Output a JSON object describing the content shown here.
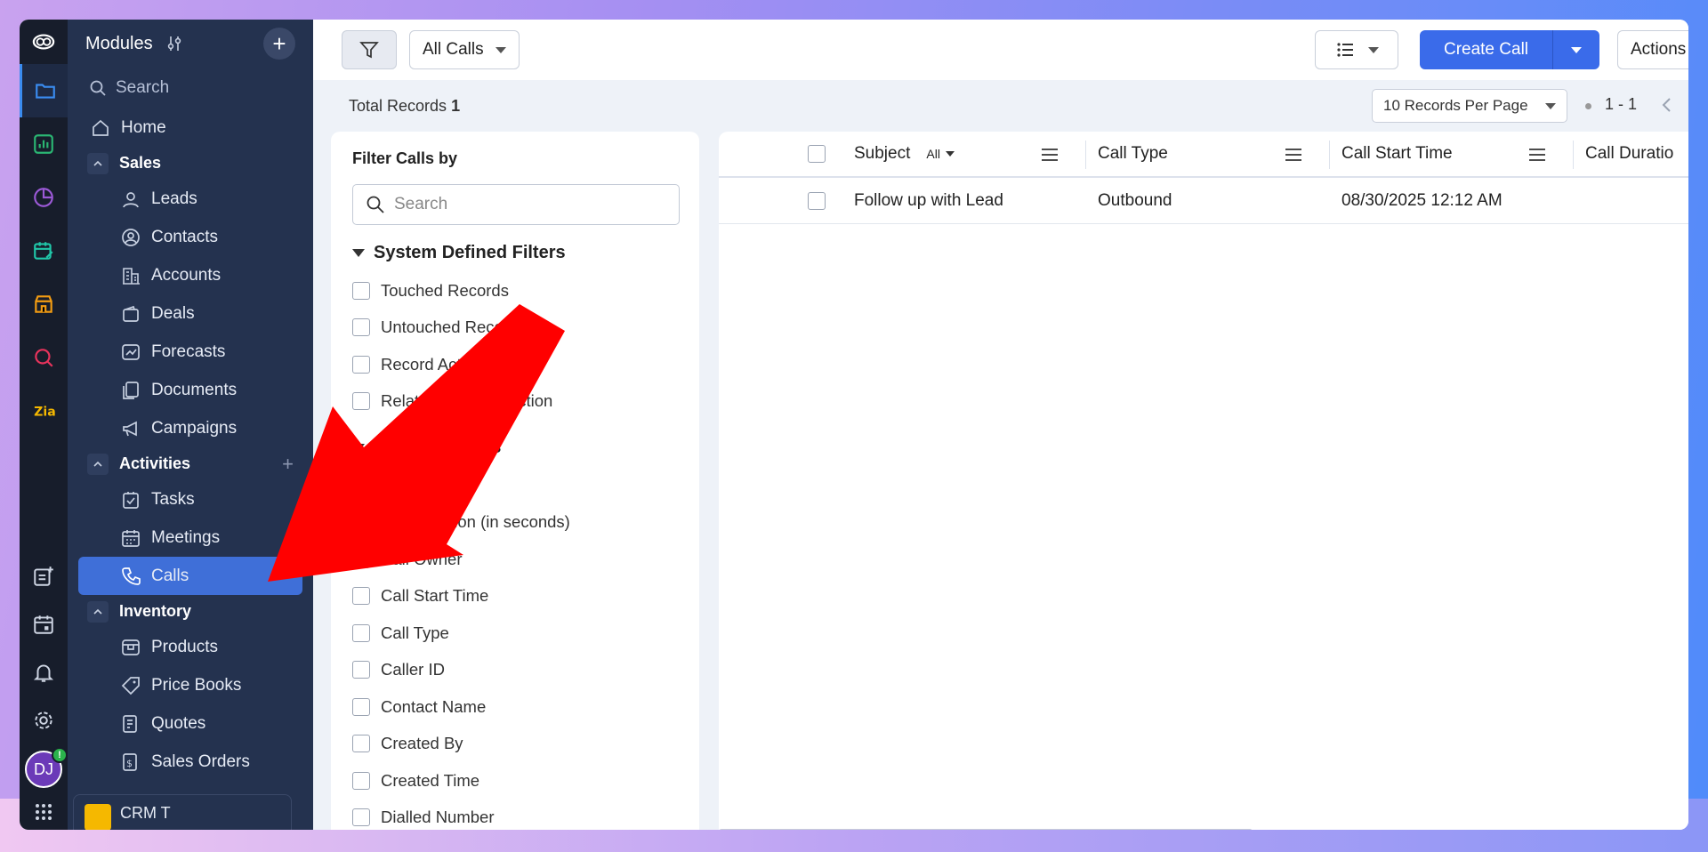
{
  "sidebar": {
    "title": "Modules",
    "search_placeholder": "Search",
    "home": "Home",
    "groups": {
      "sales": "Sales",
      "activities": "Activities",
      "inventory": "Inventory"
    },
    "sales_items": [
      "Leads",
      "Contacts",
      "Accounts",
      "Deals",
      "Forecasts",
      "Documents",
      "Campaigns"
    ],
    "activities_items": [
      "Tasks",
      "Meetings",
      "Calls"
    ],
    "inventory_items": [
      "Products",
      "Price Books",
      "Quotes",
      "Sales Orders"
    ],
    "more": "•••",
    "footer_label": "CRM T",
    "avatar_initials": "DJ",
    "avatar_badge": "!"
  },
  "toolbar": {
    "view_select": "All Calls",
    "create_label": "Create Call",
    "actions_label": "Actions"
  },
  "subbar": {
    "total_label": "Total Records",
    "total_value": "1",
    "per_page": "10 Records Per Page",
    "range": "1 - 1"
  },
  "filter_panel": {
    "title": "Filter Calls by",
    "search_placeholder": "Search",
    "system_title": "System Defined Filters",
    "system_filters": [
      "Touched Records",
      "Untouched Records",
      "Record Action",
      "Related Records Action"
    ],
    "fields_title": "Filter By Fields",
    "field_filters": [
      "Call Duration",
      "Call Duration (in seconds)",
      "Call Owner",
      "Call Start Time",
      "Call Type",
      "Caller ID",
      "Contact Name",
      "Created By",
      "Created Time",
      "Dialled Number"
    ]
  },
  "table": {
    "columns": [
      "Subject",
      "Call Type",
      "Call Start Time",
      "Call Duratio"
    ],
    "subject_filter": "All",
    "rows": [
      {
        "subject": "Follow up with Lead",
        "call_type": "Outbound",
        "start_time": "08/30/2025 12:12 AM"
      }
    ]
  },
  "colors": {
    "accent": "#3a6bea",
    "sidebar_bg": "#24324f",
    "rail_bg": "#171d2b",
    "arrow": "#ff0000"
  }
}
